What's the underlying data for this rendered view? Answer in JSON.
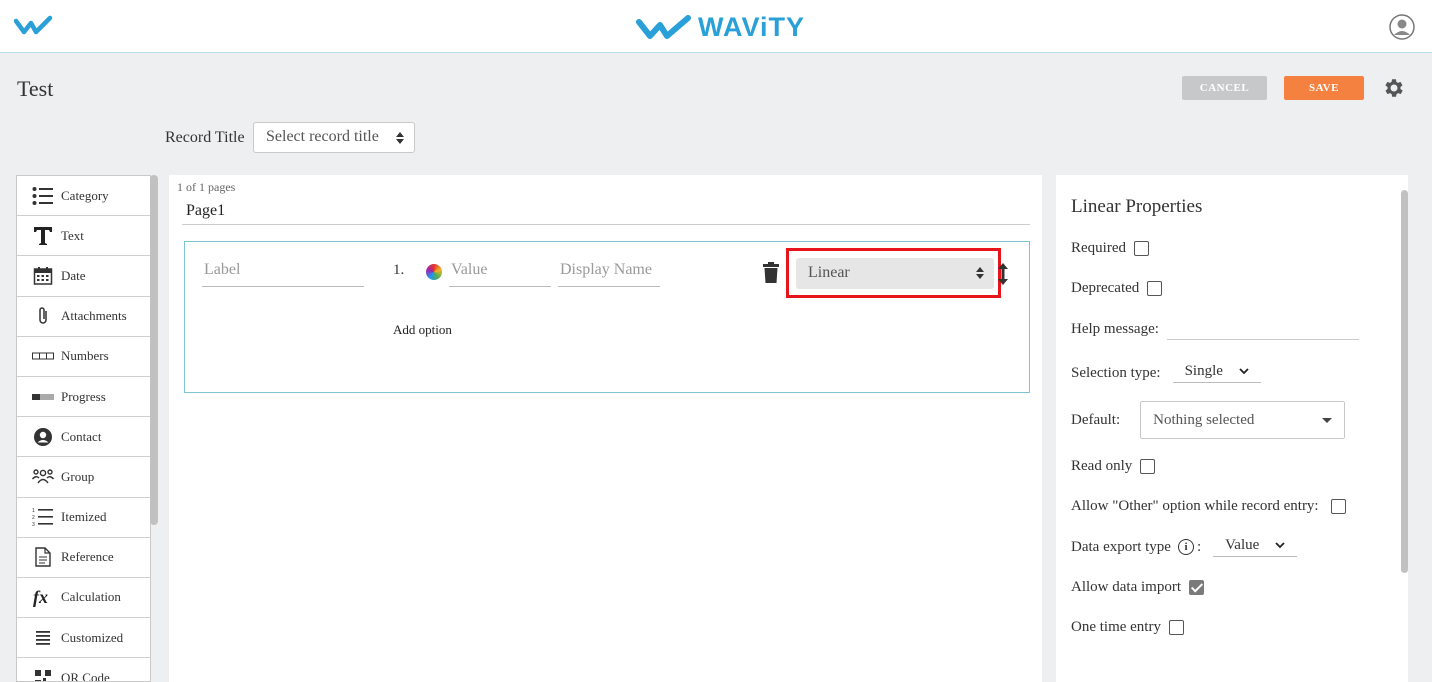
{
  "header": {
    "brand": "WAViTY"
  },
  "title_row": {
    "title": "Test",
    "cancel_label": "CANCEL",
    "save_label": "SAVE"
  },
  "record": {
    "label": "Record Title",
    "select_value": "Select record title"
  },
  "palette": {
    "items": [
      {
        "label": "Category",
        "icon": "list-bullet-icon"
      },
      {
        "label": "Text",
        "icon": "text-t-icon"
      },
      {
        "label": "Date",
        "icon": "calendar-icon"
      },
      {
        "label": "Attachments",
        "icon": "paperclip-icon"
      },
      {
        "label": "Numbers",
        "icon": "numbers-boxes-icon"
      },
      {
        "label": "Progress",
        "icon": "progress-bar-icon"
      },
      {
        "label": "Contact",
        "icon": "contact-person-icon"
      },
      {
        "label": "Group",
        "icon": "group-people-icon"
      },
      {
        "label": "Itemized",
        "icon": "numbered-list-icon"
      },
      {
        "label": "Reference",
        "icon": "document-icon"
      },
      {
        "label": "Calculation",
        "icon": "fx-icon"
      },
      {
        "label": "Customized",
        "icon": "lines-icon"
      },
      {
        "label": "QR Code",
        "icon": "qr-code-icon"
      }
    ]
  },
  "canvas": {
    "page_count": "1 of 1 pages",
    "page_name": "Page1",
    "field": {
      "label_placeholder": "Label",
      "option_number": "1.",
      "value_placeholder": "Value",
      "display_placeholder": "Display Name",
      "type_select": "Linear",
      "add_option": "Add option"
    }
  },
  "properties": {
    "title": "Linear Properties",
    "required": "Required",
    "deprecated": "Deprecated",
    "help_message": "Help message:",
    "selection_type_label": "Selection type:",
    "selection_type_value": "Single",
    "default_label": "Default:",
    "default_value": "Nothing selected",
    "read_only": "Read only",
    "allow_other": "Allow \"Other\" option while record entry:",
    "data_export_label": "Data export type",
    "data_export_value": "Value",
    "allow_import": "Allow data import",
    "one_time_entry": "One time entry"
  },
  "colors": {
    "brand_blue": "#2aa0d8",
    "save_orange": "#f4813f",
    "cancel_grey": "#c7c8ca",
    "highlight_red": "#e8141b",
    "field_border": "#7ec4d2"
  }
}
